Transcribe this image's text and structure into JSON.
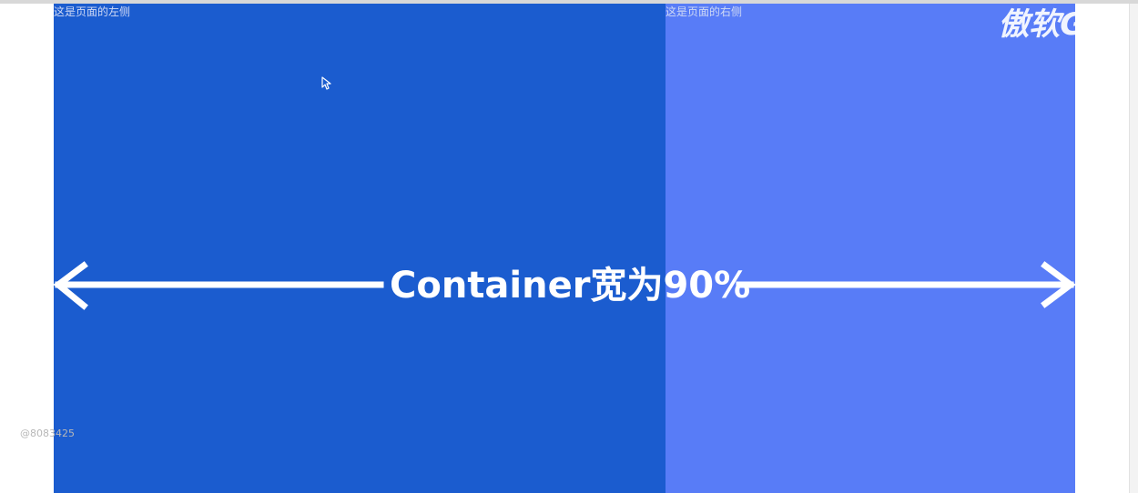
{
  "left_pane": {
    "label": "这是页面的左侧"
  },
  "right_pane": {
    "label": "这是页面的右侧"
  },
  "annotation": {
    "text": "Container宽为90%"
  },
  "watermark": {
    "text": "傲软GIF"
  },
  "user_tag": {
    "text": "@8083425"
  },
  "colors": {
    "left_pane": "#1b5ccf",
    "right_pane": "#587cf7",
    "arrow": "#ffffff"
  },
  "icons": {
    "arrow_left": "arrow-left-icon",
    "arrow_right": "arrow-right-icon",
    "cursor": "mouse-cursor-icon"
  }
}
